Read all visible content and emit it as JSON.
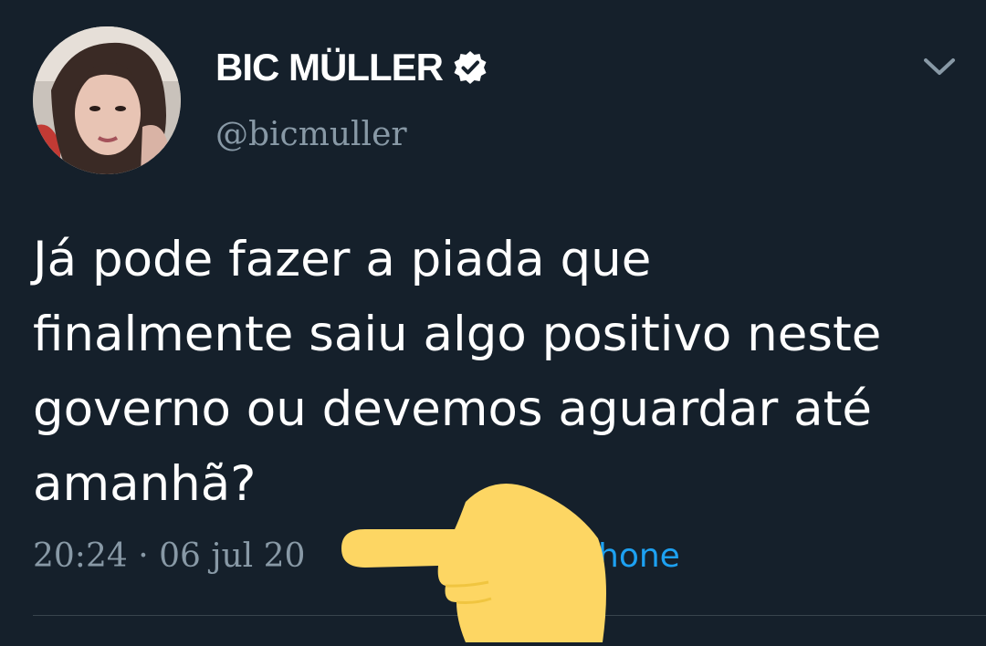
{
  "tweet": {
    "author": {
      "display_name": "BIC MÜLLER",
      "handle": "@bicmuller",
      "verified": true
    },
    "text": "Já pode fazer a piada que\nfinalmente saiu algo positivo neste\ngoverno ou devemos aguardar até\namanhã?",
    "timestamp_visible": "20:24 · 06 jul 20",
    "source_visible": "hone"
  },
  "icons": {
    "verified": "verified-badge-icon",
    "menu": "chevron-down-icon",
    "overlay": "pointing-hand-emoji"
  },
  "colors": {
    "background": "#15202b",
    "text_primary": "#ffffff",
    "text_secondary": "#8899a6",
    "link": "#1da1f2",
    "hand": "#fdd663"
  }
}
